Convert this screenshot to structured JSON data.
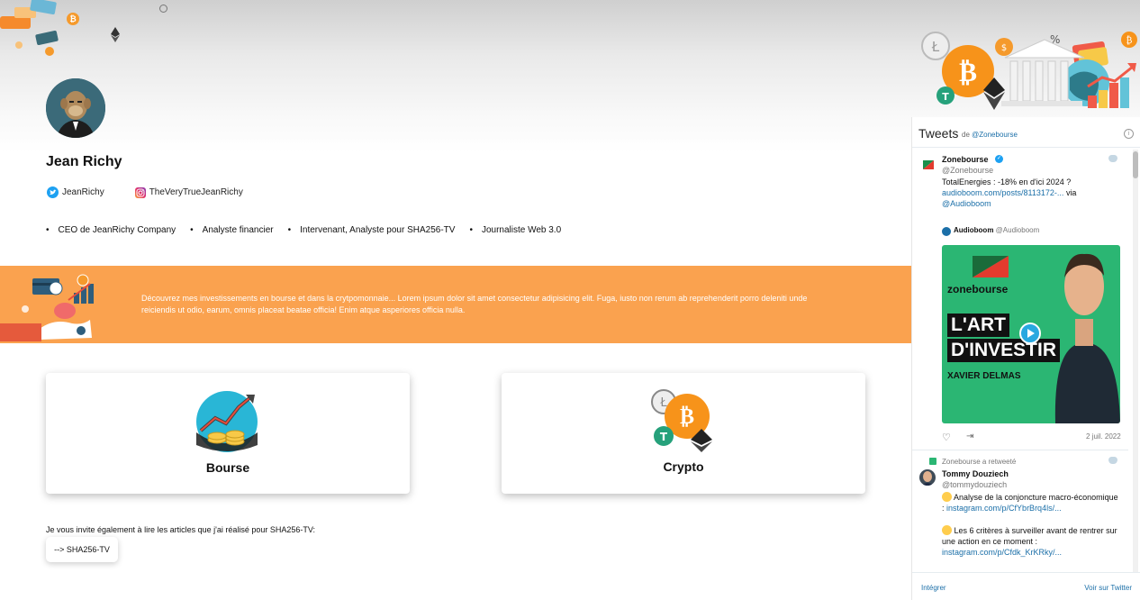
{
  "profile": {
    "name": "Jean Richy",
    "twitter": "JeanRichy",
    "instagram": "TheVeryTrueJeanRichy",
    "roles": [
      "CEO de JeanRichy Company",
      "Analyste financier",
      "Intervenant, Analyste pour SHA256-TV",
      "Journaliste Web 3.0"
    ]
  },
  "banner": {
    "text": "Découvrez mes investissements en bourse et dans la crytpomonnaie... Lorem ipsum dolor sit amet consectetur adipisicing elit. Fuga, iusto non rerum ab reprehenderit porro deleniti unde reiciendis ut odio, earum, omnis placeat beatae officia! Enim atque asperiores officia nulla."
  },
  "cards": [
    {
      "title": "Bourse"
    },
    {
      "title": "Crypto"
    }
  ],
  "invite": {
    "text": "Je vous invite également à lire les articles que j'ai réalisé pour SHA256-TV:",
    "button": "--> SHA256-TV"
  },
  "twitter": {
    "title": "Tweets",
    "by_prefix": "de",
    "by_handle": "@Zonebourse",
    "tweet1": {
      "name": "Zonebourse",
      "handle": "@Zonebourse",
      "text": "TotalEnergies : -18% en d'ici 2024 ?",
      "link": "audioboom.com/posts/8113172-...",
      "via": "via",
      "via_handle": "@Audioboom",
      "card_name": "Audioboom",
      "card_handle": "@Audioboom",
      "card_brand": "zonebourse",
      "card_title1": "L'ART",
      "card_title2": "D'INVESTIR",
      "card_person": "XAVIER DELMAS",
      "date": "2 juil. 2022"
    },
    "retweet_label": "Zonebourse a retweeté",
    "tweet2": {
      "name": "Tommy Douziech",
      "handle": "@tommydouziech",
      "line1": "Analyse de la conjoncture macro-économique :",
      "link1": "instagram.com/p/CfYbrBrq4ls/...",
      "line2": "Les 6 critères à surveiller avant de rentrer sur une action en ce moment :",
      "link2": "instagram.com/p/Cfdk_KrKRky/..."
    },
    "footer_embed": "Intégrer",
    "footer_view": "Voir sur Twitter"
  },
  "colors": {
    "banner": "#faa24f",
    "twitter_blue": "#1da1f2",
    "bitcoin": "#f7931a",
    "tether": "#26a17b"
  }
}
